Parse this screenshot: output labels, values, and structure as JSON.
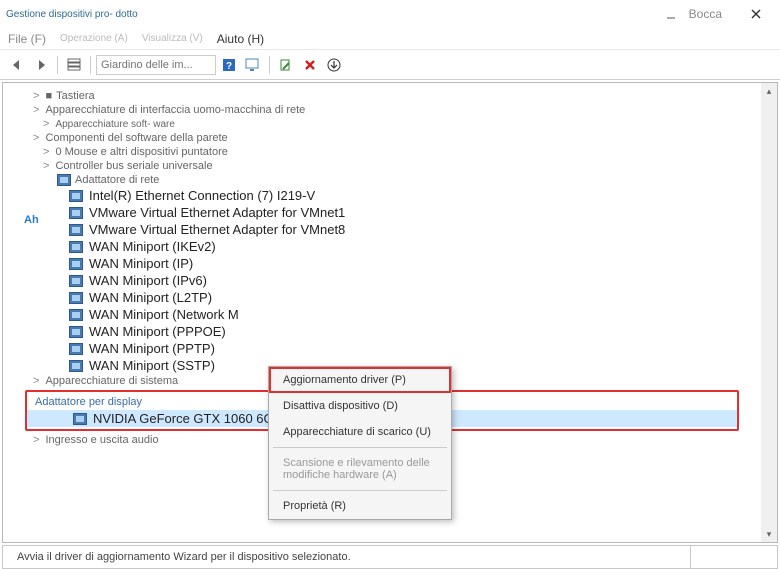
{
  "window": {
    "title": "Gestione dispositivi pro-\ndotto",
    "user": "Bocca"
  },
  "menu": {
    "file": "File (F)",
    "op": "Operazione (A)",
    "viz": "Visualizza (V)",
    "help": "Aiuto (H)"
  },
  "toolbar": {
    "search_ph": "Giardino delle im..."
  },
  "tree": {
    "tastiera": "Tastiera",
    "apparecchiature_hmi": "Apparecchiature di interfaccia uomo-macchina di rete",
    "apparecchiature_soft": "Apparecchiature soft-\nware",
    "componenti_wall": "Componenti del software della parete",
    "mouse": "0 Mouse e altri dispositivi puntatore",
    "usb": "Controller bus seriale universale",
    "network_adapter": "Adattatore di rete",
    "net_devices": [
      "Intel(R) Ethernet Connection (7) I219-V",
      "VMware Virtual Ethernet Adapter for VMnet1",
      "VMware Virtual Ethernet Adapter for VMnet8",
      "WAN Miniport (IKEv2)",
      "WAN Miniport (IP)",
      "WAN Miniport (IPv6)",
      "WAN Miniport (L2TP)",
      "WAN Miniport (Network M",
      "WAN Miniport (PPPOE)",
      "WAN Miniport (PPTP)",
      "WAN Miniport (SSTP)"
    ],
    "sys_eq": "Apparecchiature di sistema",
    "display_adapter": "Adattatore per display",
    "gpu": "NVIDIA GeForce GTX 1060 6GB",
    "audio_io": "Ingresso e uscita audio"
  },
  "context": {
    "update": "Aggiornamento driver (P)",
    "disable": "Disattiva dispositivo (D)",
    "uninstall": "Apparecchiature di scarico (U)",
    "scan": "Scansione e rilevamento delle modifiche hardware (A)",
    "props": "Proprietà (R)"
  },
  "status": {
    "text": "Avvia il driver di aggiornamento Wizard per il dispositivo selezionato."
  },
  "ah": "Ah"
}
